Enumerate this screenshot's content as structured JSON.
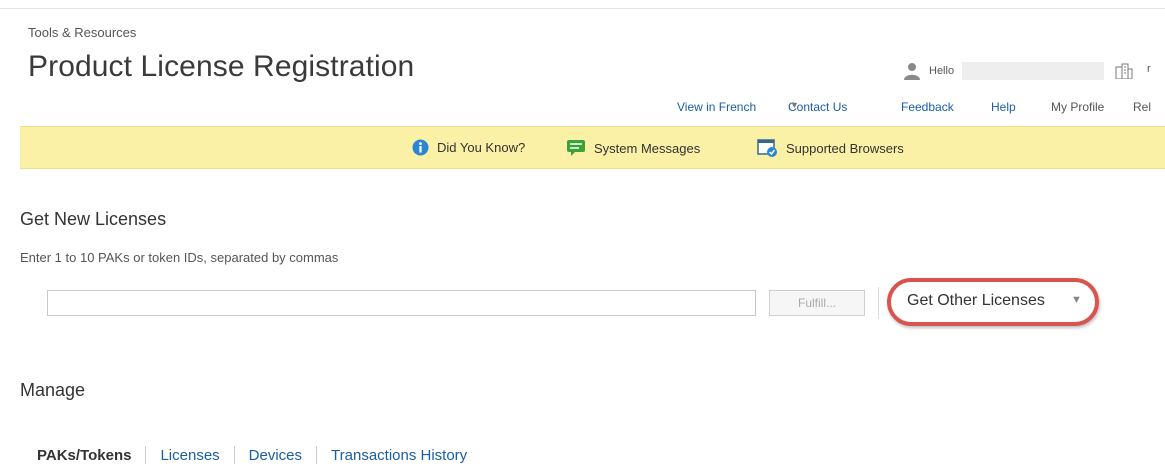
{
  "header": {
    "breadcrumb": "Tools & Resources",
    "title": "Product License Registration",
    "greeting": "Hello"
  },
  "top_links": [
    {
      "label": "View in French"
    },
    {
      "label": "Contact Us",
      "caret": "▼"
    },
    {
      "label": "Feedback"
    },
    {
      "label": "Help"
    },
    {
      "label": "My Profile"
    },
    {
      "label": "Rel"
    }
  ],
  "banner": {
    "items": [
      {
        "label": "Did You Know?",
        "icon": "info-icon"
      },
      {
        "label": "System Messages",
        "icon": "message-icon"
      },
      {
        "label": "Supported Browsers",
        "icon": "browser-check-icon"
      }
    ]
  },
  "get_licenses": {
    "heading": "Get New Licenses",
    "hint": "Enter 1 to 10 PAKs or token IDs, separated by commas",
    "input_value": "",
    "fulfill_label": "Fulfill...",
    "other_label": "Get Other Licenses",
    "other_caret": "▼"
  },
  "manage": {
    "heading": "Manage",
    "tabs": [
      {
        "label": "PAKs/Tokens",
        "active": true
      },
      {
        "label": "Licenses",
        "active": false
      },
      {
        "label": "Devices",
        "active": false
      },
      {
        "label": "Transactions History",
        "active": false
      }
    ]
  },
  "colors": {
    "banner_bg": "#faf0a6",
    "link": "#1a5ea8",
    "highlight_ring": "#d9534f"
  }
}
